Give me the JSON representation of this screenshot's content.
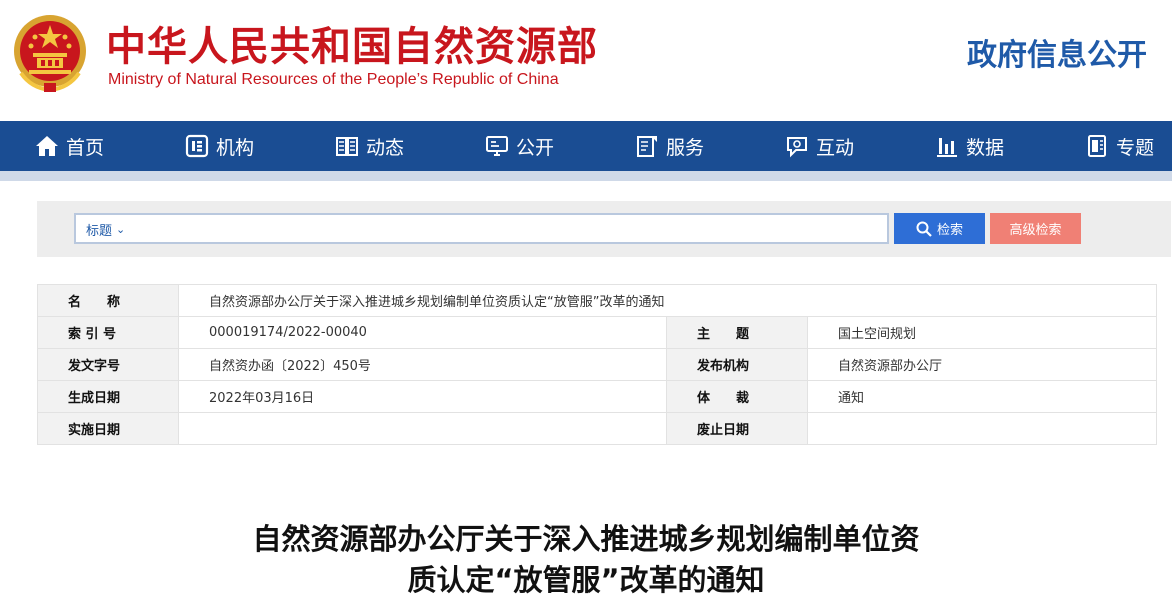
{
  "header": {
    "ministry_cn": "中华人民共和国自然资源部",
    "ministry_en": "Ministry of Natural Resources of the People’s Republic of China",
    "gov_open": "政府信息公开",
    "emblem_icon": "national-emblem-icon"
  },
  "nav": {
    "items": [
      {
        "label": "首页",
        "icon": "home-icon"
      },
      {
        "label": "机构",
        "icon": "organization-icon"
      },
      {
        "label": "动态",
        "icon": "book-icon"
      },
      {
        "label": "公开",
        "icon": "monitor-icon"
      },
      {
        "label": "服务",
        "icon": "edit-icon"
      },
      {
        "label": "互动",
        "icon": "chat-icon"
      },
      {
        "label": "数据",
        "icon": "bar-chart-icon"
      },
      {
        "label": "专题",
        "icon": "document-icon"
      }
    ]
  },
  "search": {
    "field_selected": "标题",
    "value": "",
    "search_label": "检索",
    "advanced_label": "高级检索"
  },
  "info": {
    "name_label": "名　　称",
    "name_value": "自然资源部办公厅关于深入推进城乡规划编制单位资质认定“放管服”改革的通知",
    "index_label": "索 引 号",
    "index_value": "000019174/2022-00040",
    "subject_label": "主　　题",
    "subject_value": "国土空间规划",
    "docno_label": "发文字号",
    "docno_value": "自然资办函〔2022〕450号",
    "issuer_label": "发布机构",
    "issuer_value": "自然资源部办公厅",
    "date_label": "生成日期",
    "date_value": "2022年03月16日",
    "genre_label": "体　　裁",
    "genre_value": "通知",
    "effective_label": "实施日期",
    "effective_value": "",
    "repeal_label": "废止日期",
    "repeal_value": ""
  },
  "doc": {
    "title_line1": "自然资源部办公厅关于深入推进城乡规划编制单位资",
    "title_line2": "质认定“放管服”改革的通知"
  },
  "colors": {
    "brand_red": "#c8161d",
    "nav_blue": "#1a4d93",
    "search_blue": "#2e6ed6",
    "advanced_red": "#f08075"
  }
}
